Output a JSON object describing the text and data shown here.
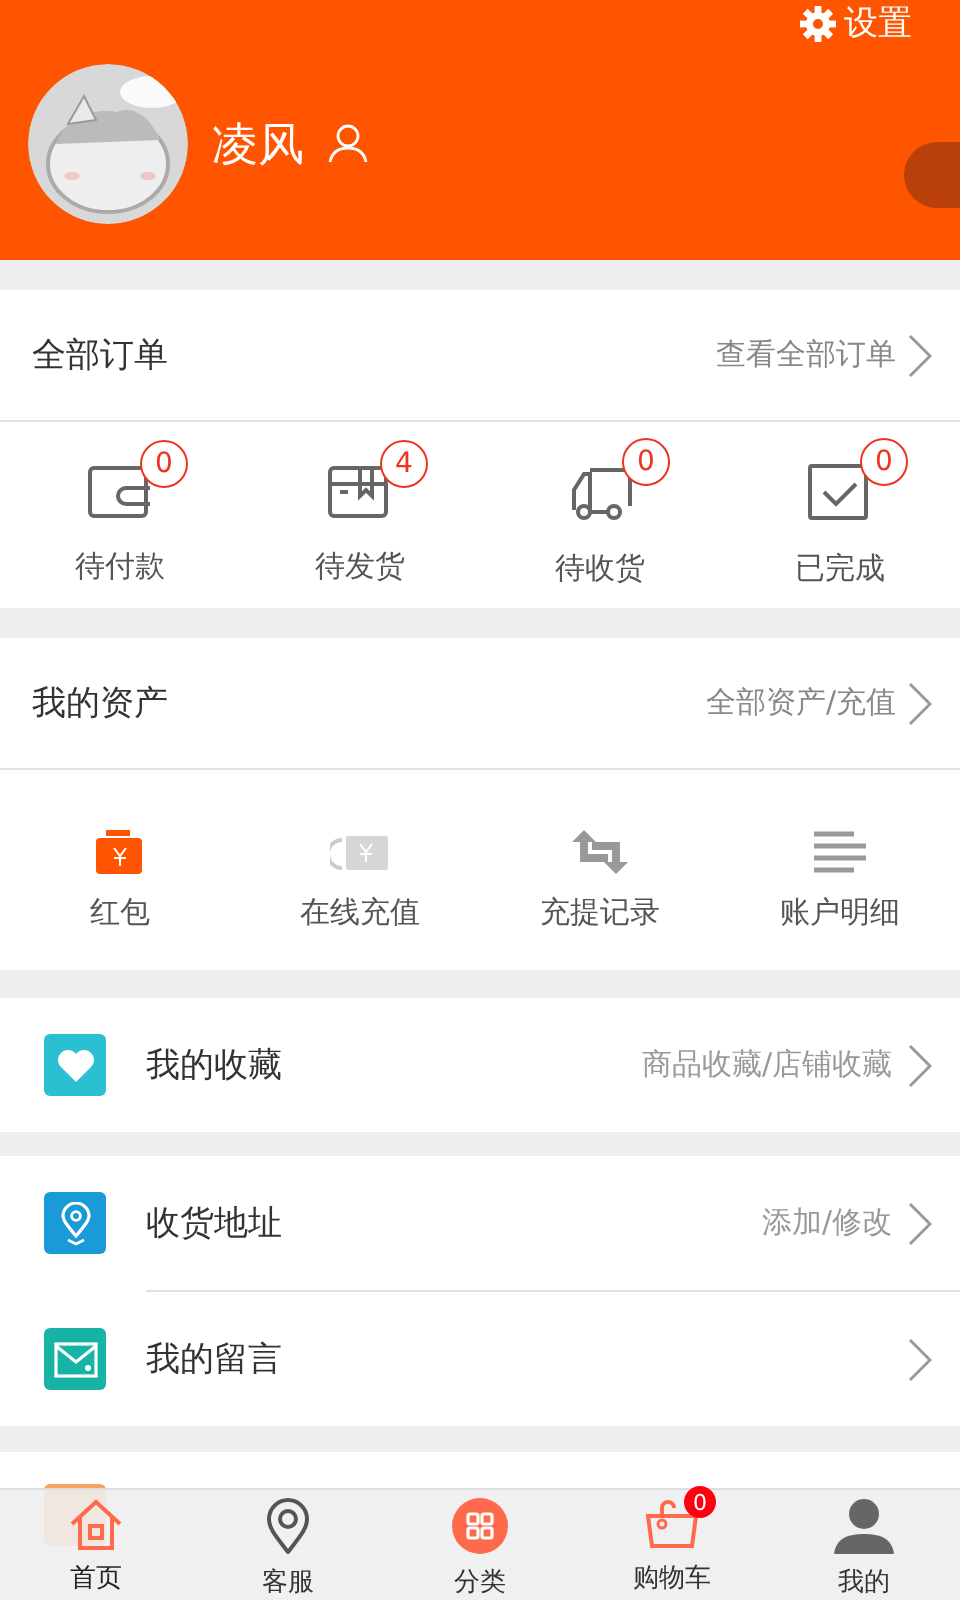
{
  "header": {
    "settings": "设置",
    "username": "凌风"
  },
  "orders": {
    "title": "全部订单",
    "link": "查看全部订单",
    "items": [
      {
        "label": "待付款",
        "count": "0"
      },
      {
        "label": "待发货",
        "count": "4"
      },
      {
        "label": "待收货",
        "count": "0"
      },
      {
        "label": "已完成",
        "count": "0"
      }
    ]
  },
  "assets": {
    "title": "我的资产",
    "link": "全部资产/充值",
    "items": [
      {
        "label": "红包"
      },
      {
        "label": "在线充值"
      },
      {
        "label": "充提记录"
      },
      {
        "label": "账户明细"
      }
    ]
  },
  "menu_groups": [
    [
      {
        "label": "我的收藏",
        "hint": "商品收藏/店铺收藏",
        "color": "#2bbfd2"
      }
    ],
    [
      {
        "label": "收货地址",
        "hint": "添加/修改",
        "color": "#1a9ad6"
      },
      {
        "label": "我的留言",
        "color": "#17b3a4"
      }
    ]
  ],
  "nav": [
    {
      "label": "首页",
      "selected": true
    },
    {
      "label": "客服",
      "selected": false
    },
    {
      "label": "分类",
      "selected": false
    },
    {
      "label": "购物车",
      "selected": false,
      "badge": "0"
    },
    {
      "label": "我的",
      "selected": false
    }
  ]
}
